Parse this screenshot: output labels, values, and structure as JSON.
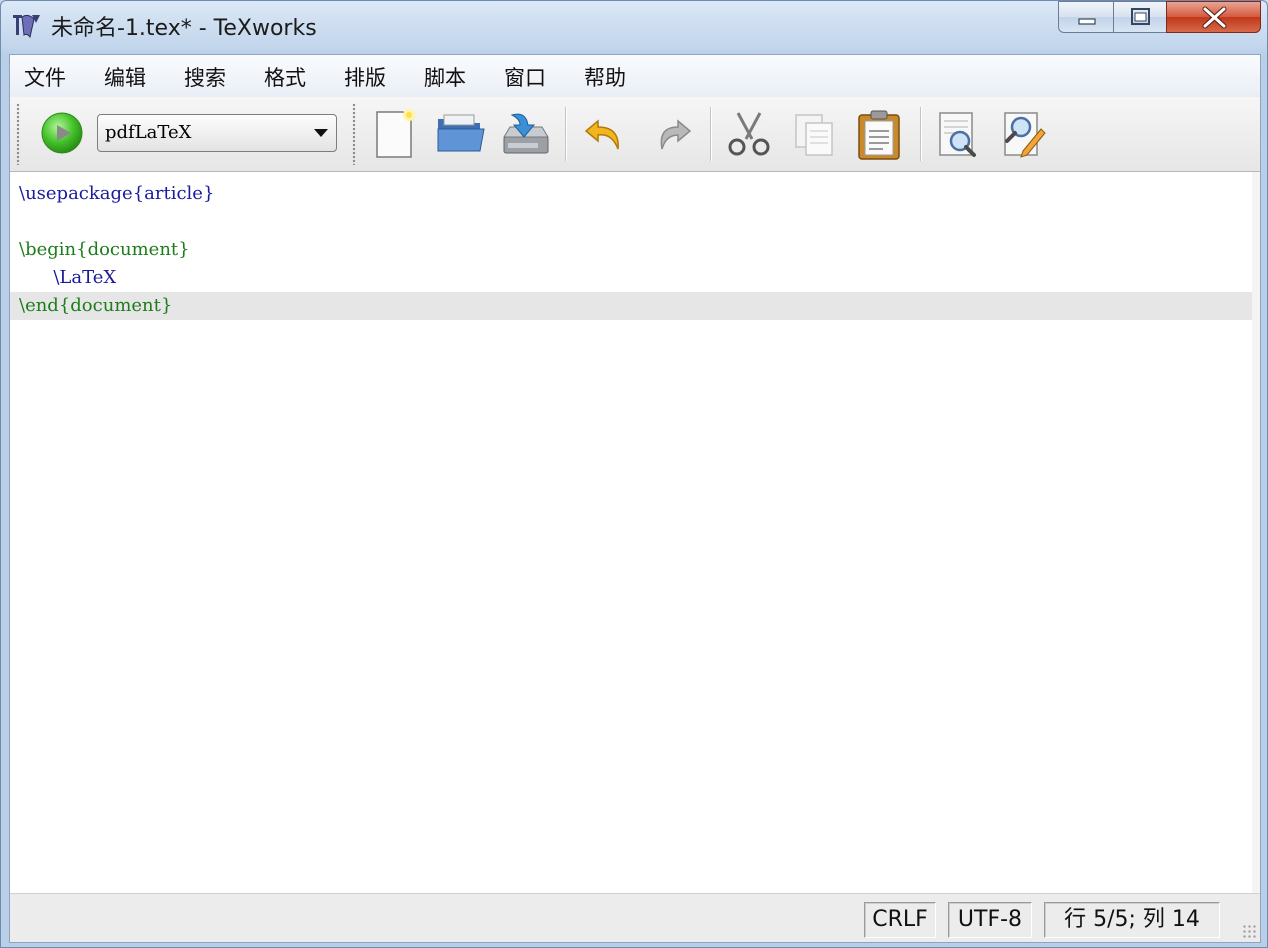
{
  "window": {
    "title": "未命名-1.tex* - TeXworks",
    "icon": "texworks-app-icon",
    "controls": {
      "minimize": "minimize-icon",
      "maximize": "maximize-icon",
      "close": "close-icon"
    }
  },
  "menubar": {
    "items": [
      "文件",
      "编辑",
      "搜索",
      "格式",
      "排版",
      "脚本",
      "窗口",
      "帮助"
    ]
  },
  "toolbar": {
    "run_icon": "play-icon",
    "engine": "pdfLaTeX",
    "buttons": [
      {
        "name": "new-document",
        "icon": "new-document-icon"
      },
      {
        "name": "open",
        "icon": "open-folder-icon"
      },
      {
        "name": "save",
        "icon": "save-icon"
      },
      {
        "name": "undo",
        "icon": "undo-icon"
      },
      {
        "name": "redo",
        "icon": "redo-icon"
      },
      {
        "name": "cut",
        "icon": "scissors-icon"
      },
      {
        "name": "copy",
        "icon": "copy-icon"
      },
      {
        "name": "paste",
        "icon": "paste-icon"
      },
      {
        "name": "find",
        "icon": "find-icon"
      },
      {
        "name": "replace",
        "icon": "replace-icon"
      }
    ]
  },
  "editor": {
    "lines": [
      {
        "parts": [
          {
            "text": "\\usepackage{article}",
            "kind": "cmd"
          }
        ]
      },
      {
        "parts": []
      },
      {
        "parts": [
          {
            "text": "\\begin{document}",
            "kind": "env"
          }
        ]
      },
      {
        "parts": [
          {
            "text": "      \\LaTeX",
            "kind": "cmd"
          }
        ]
      },
      {
        "parts": [
          {
            "text": "\\end{document}",
            "kind": "env"
          }
        ]
      }
    ],
    "current_line": 5,
    "colors": {
      "command": "#1a1a9c",
      "environment": "#1d7d1d",
      "current_line_bg": "#e6e6e6"
    }
  },
  "statusbar": {
    "line_ending": "CRLF",
    "encoding": "UTF-8",
    "position": "行 5/5; 列 14"
  }
}
